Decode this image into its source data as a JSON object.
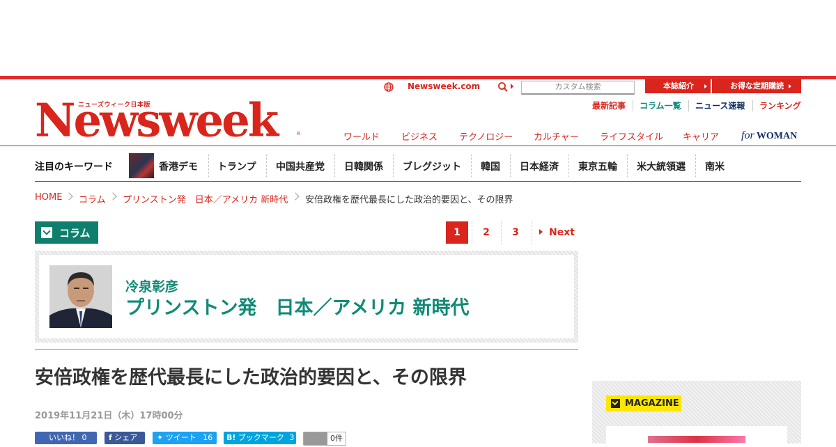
{
  "header": {
    "logo_sub": "ニューズウィーク日本版",
    "logo": "Newsweek",
    "logo_reg": "®",
    "site_link": "Newsweek.com",
    "search_placeholder": "カスタム検索",
    "tab_about": "本誌紹介",
    "tab_subscribe": "お得な定期購読",
    "util_links": [
      "最新記事",
      "コラム一覧",
      "ニュース速報",
      "ランキング"
    ],
    "util_colors": [
      "#d9251c",
      "#0f8a76",
      "#0c2c5e",
      "#d9251c"
    ],
    "nav": [
      "ワールド",
      "ビジネス",
      "テクノロジー",
      "カルチャー",
      "ライフスタイル",
      "キャリア"
    ],
    "for_woman_for": "for",
    "for_woman": "WOMAN"
  },
  "keywords": {
    "label": "注目のキーワード",
    "items": [
      "香港デモ",
      "トランプ",
      "中国共産党",
      "日韓関係",
      "ブレグジット",
      "韓国",
      "日本経済",
      "東京五輪",
      "米大統領選",
      "南米"
    ]
  },
  "breadcrumb": {
    "items": [
      "HOME",
      "コラム",
      "プリンストン発　日本／アメリカ 新時代"
    ],
    "current": "安倍政権を歴代最長にした政治的要因と、その限界"
  },
  "column_label": "コラム",
  "pager": {
    "pages": [
      "1",
      "2",
      "3"
    ],
    "active": "1",
    "next": "Next"
  },
  "author": {
    "name": "冷泉彰彦",
    "column_title": "プリンストン発　日本／アメリカ 新時代"
  },
  "article": {
    "headline": "安倍政権を歴代最長にした政治的要因と、その限界",
    "date": "2019年11月21日（木）17時00分"
  },
  "share": {
    "like": "いいね！ 0",
    "share": "シェア",
    "tweet": "ツイート",
    "tweet_count": "16",
    "hatena": "ブックマーク",
    "hatena_count": "3",
    "pocket_count": "0件"
  },
  "sidebar": {
    "magazine_label": "MAGAZINE"
  },
  "colors": {
    "brand_red": "#d9251c",
    "teal": "#0f8a76",
    "navy": "#0c2c5e"
  }
}
